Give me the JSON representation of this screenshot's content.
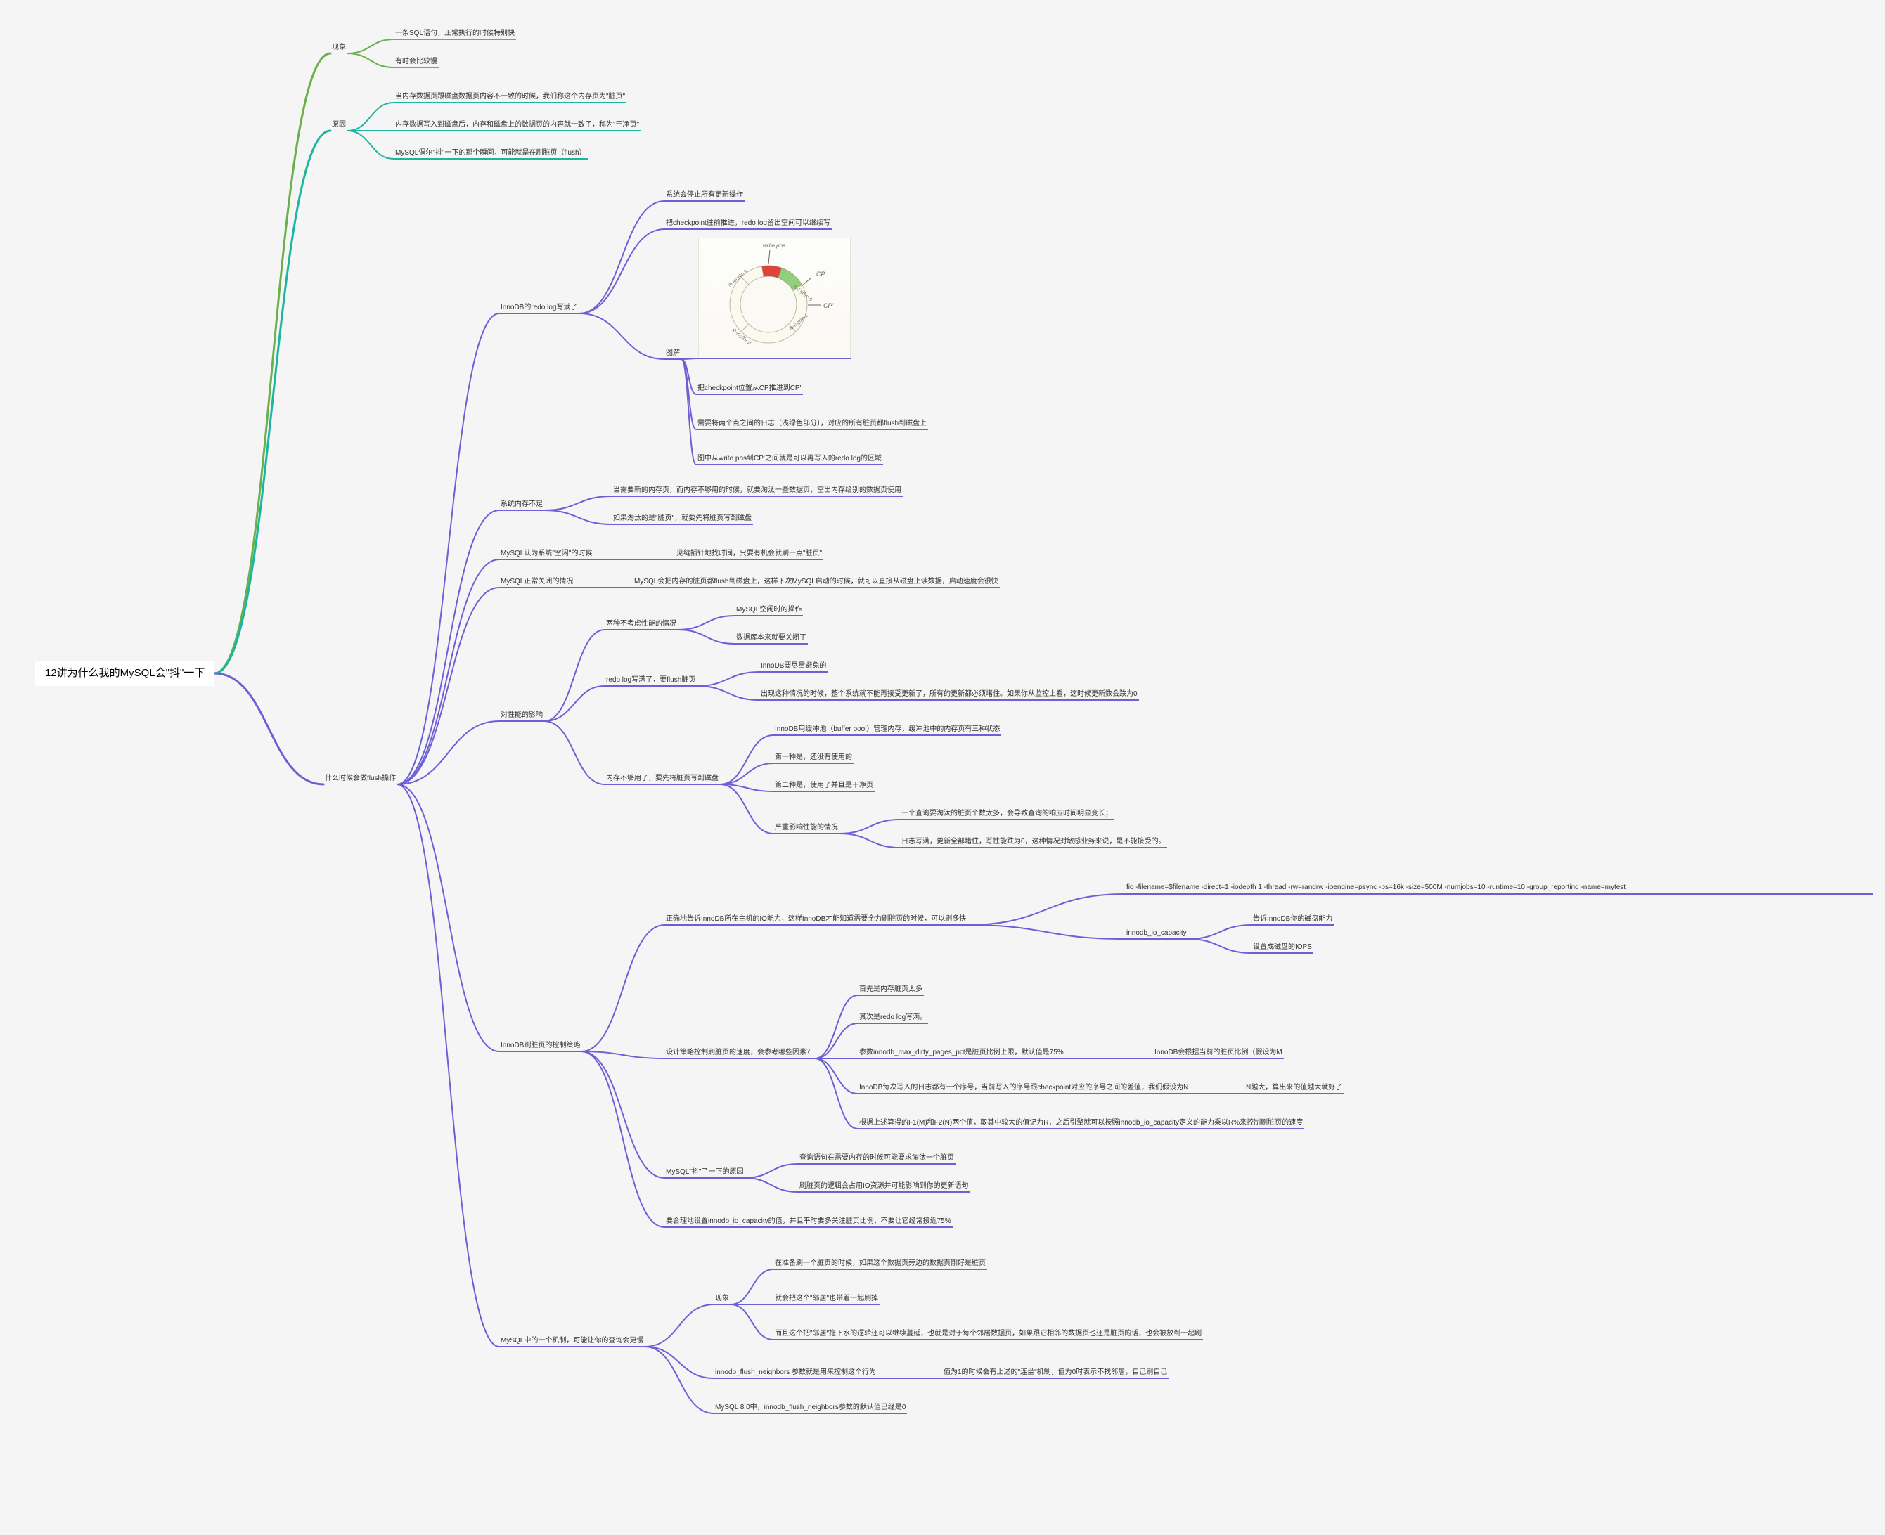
{
  "root": "12讲为什么我的MySQL会\"抖\"一下",
  "phenomenon": {
    "title": "现象",
    "a": "一条SQL语句，正常执行的时候特别快",
    "b": "有时会比较慢"
  },
  "reason": {
    "title": "原因",
    "a": "当内存数据页跟磁盘数据页内容不一致的时候，我们称这个内存页为\"脏页\"",
    "b": "内存数据写入到磁盘后，内存和磁盘上的数据页的内容就一致了，称为\"干净页\"",
    "c": "MySQL偶尔\"抖\"一下的那个瞬间，可能就是在刷脏页（flush）"
  },
  "flush_when": "什么时候会做flush操作",
  "redo_full": {
    "title": "InnoDB的redo log写满了",
    "a": "系统会停止所有更新操作",
    "b": "把checkpoint往前推进，redo log留出空间可以继续写",
    "diagram": "图解",
    "d1": "把checkpoint位置从CP推进到CP'",
    "d2": "需要将两个点之间的日志（浅绿色部分），对应的所有脏页都flush到磁盘上",
    "d3": "图中从write pos到CP'之间就是可以再写入的redo log的区域",
    "ck": {
      "wp": "write pos",
      "cp": "CP",
      "cp2": "CP'",
      "f0": "ib-logfile-0",
      "f1": "ib-logfile-1",
      "f2": "ib-logfile-2",
      "f3": "ib-logfile-3"
    }
  },
  "mem_short": {
    "title": "系统内存不足",
    "a": "当需要新的内存页，而内存不够用的时候，就要淘汰一些数据页，空出内存给别的数据页使用",
    "b": "如果淘汰的是\"脏页\"，就要先将脏页写到磁盘"
  },
  "idle": {
    "title": "MySQL认为系统\"空闲\"的时候",
    "a": "见缝插针地找时间，只要有机会就刷一点\"脏页\""
  },
  "shutdown": {
    "title": "MySQL正常关闭的情况",
    "a": "MySQL会把内存的脏页都flush到磁盘上，这样下次MySQL启动的时候，就可以直接从磁盘上读数据，启动速度会很快"
  },
  "perf": {
    "title": "对性能的影响",
    "no_care": {
      "title": "两种不考虑性能的情况",
      "a": "MySQL空闲时的操作",
      "b": "数据库本来就要关闭了"
    },
    "redo": {
      "title": "redo log写满了，要flush脏页",
      "a": "InnoDB要尽量避免的",
      "b": "出现这种情况的时候，整个系统就不能再接受更新了，所有的更新都必须堵住。如果你从监控上看，这时候更新数会跌为0"
    },
    "mem": {
      "title": "内存不够用了，要先将脏页写到磁盘",
      "a": "InnoDB用缓冲池（buffer pool）管理内存，缓冲池中的内存页有三种状态",
      "b": "第一种是，还没有使用的",
      "c": "第二种是，使用了并且是干净页",
      "bad": {
        "title": "严重影响性能的情况",
        "a": "一个查询要淘汰的脏页个数太多，会导致查询的响应时间明显变长；",
        "b": "日志写满，更新全部堵住，写性能跌为0，这种情况对敏感业务来说，是不能接受的。"
      }
    }
  },
  "strategy": {
    "title": "InnoDB刷脏页的控制策略",
    "io": {
      "title": "正确地告诉InnoDB所在主机的IO能力，这样InnoDB才能知道需要全力刷脏页的时候，可以刷多快",
      "fio": "fio -filename=$filename -direct=1 -iodepth 1 -thread -rw=randrw -ioengine=psync -bs=16k -size=500M -numjobs=10 -runtime=10 -group_reporting -name=mytest",
      "cap": "innodb_io_capacity",
      "cap_a": "告诉InnoDB你的磁盘能力",
      "cap_b": "设置成磁盘的IOPS"
    },
    "speed": {
      "title": "设计策略控制刷脏页的速度，会参考哪些因素？",
      "a": "首先是内存脏页太多",
      "b": "其次是redo log写满。",
      "c": "参数innodb_max_dirty_pages_pct是脏页比例上限，默认值是75%",
      "c2": "InnoDB会根据当前的脏页比例（假设为M",
      "d": "InnoDB每次写入的日志都有一个序号，当前写入的序号跟checkpoint对应的序号之间的差值，我们假设为N",
      "d2": "N越大，算出来的值越大就好了",
      "e": "根据上述算得的F1(M)和F2(N)两个值，取其中较大的值记为R，之后引擎就可以按照innodb_io_capacity定义的能力乘以R%来控制刷脏页的速度"
    },
    "pause": {
      "title": "MySQL\"抖\"了一下的原因",
      "a": "查询语句在需要内存的时候可能要求淘汰一个脏页",
      "b": "刷脏页的逻辑会占用IO资源并可能影响到你的更新语句"
    },
    "care": "要合理地设置innodb_io_capacity的值，并且平时要多关注脏页比例，不要让它经常接近75%"
  },
  "neighbor": {
    "title": "MySQL中的一个机制，可能让你的查询会更慢",
    "phen": "现象",
    "a": "在准备刷一个脏页的时候，如果这个数据页旁边的数据页刚好是脏页",
    "b": "就会把这个\"邻居\"也带着一起刷掉",
    "c": "而且这个把\"邻居\"拖下水的逻辑还可以继续蔓延，也就是对于每个邻居数据页，如果跟它相邻的数据页也还是脏页的话，也会被放到一起刷",
    "nb": "innodb_flush_neighbors 参数就是用来控制这个行为",
    "nb_a": "值为1的时候会有上述的\"连坐\"机制，值为0时表示不找邻居，自己刷自己",
    "v8": "MySQL 8.0中，innodb_flush_neighbors参数的默认值已经是0"
  }
}
